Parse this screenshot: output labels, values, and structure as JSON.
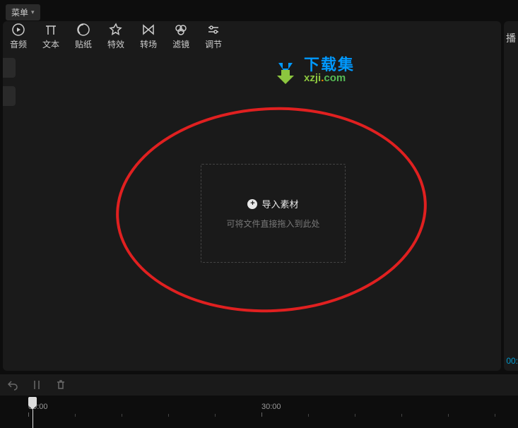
{
  "menu": {
    "label": "菜单"
  },
  "toolbar": {
    "items": [
      {
        "label": "音频"
      },
      {
        "label": "文本"
      },
      {
        "label": "贴纸"
      },
      {
        "label": "特效"
      },
      {
        "label": "转场"
      },
      {
        "label": "滤镜"
      },
      {
        "label": "调节"
      }
    ]
  },
  "right_panel": {
    "label": "播"
  },
  "dropzone": {
    "title": "导入素材",
    "hint": "可将文件直接拖入到此处"
  },
  "watermark": {
    "line1": "下载集",
    "line2_a": "xzji",
    "line2_dot": ".",
    "line2_b": "com"
  },
  "right_time": "00:",
  "timeline": {
    "ticks": [
      {
        "pos": 0,
        "label": "00:00"
      },
      {
        "pos": 330,
        "label": "30:00"
      }
    ]
  }
}
